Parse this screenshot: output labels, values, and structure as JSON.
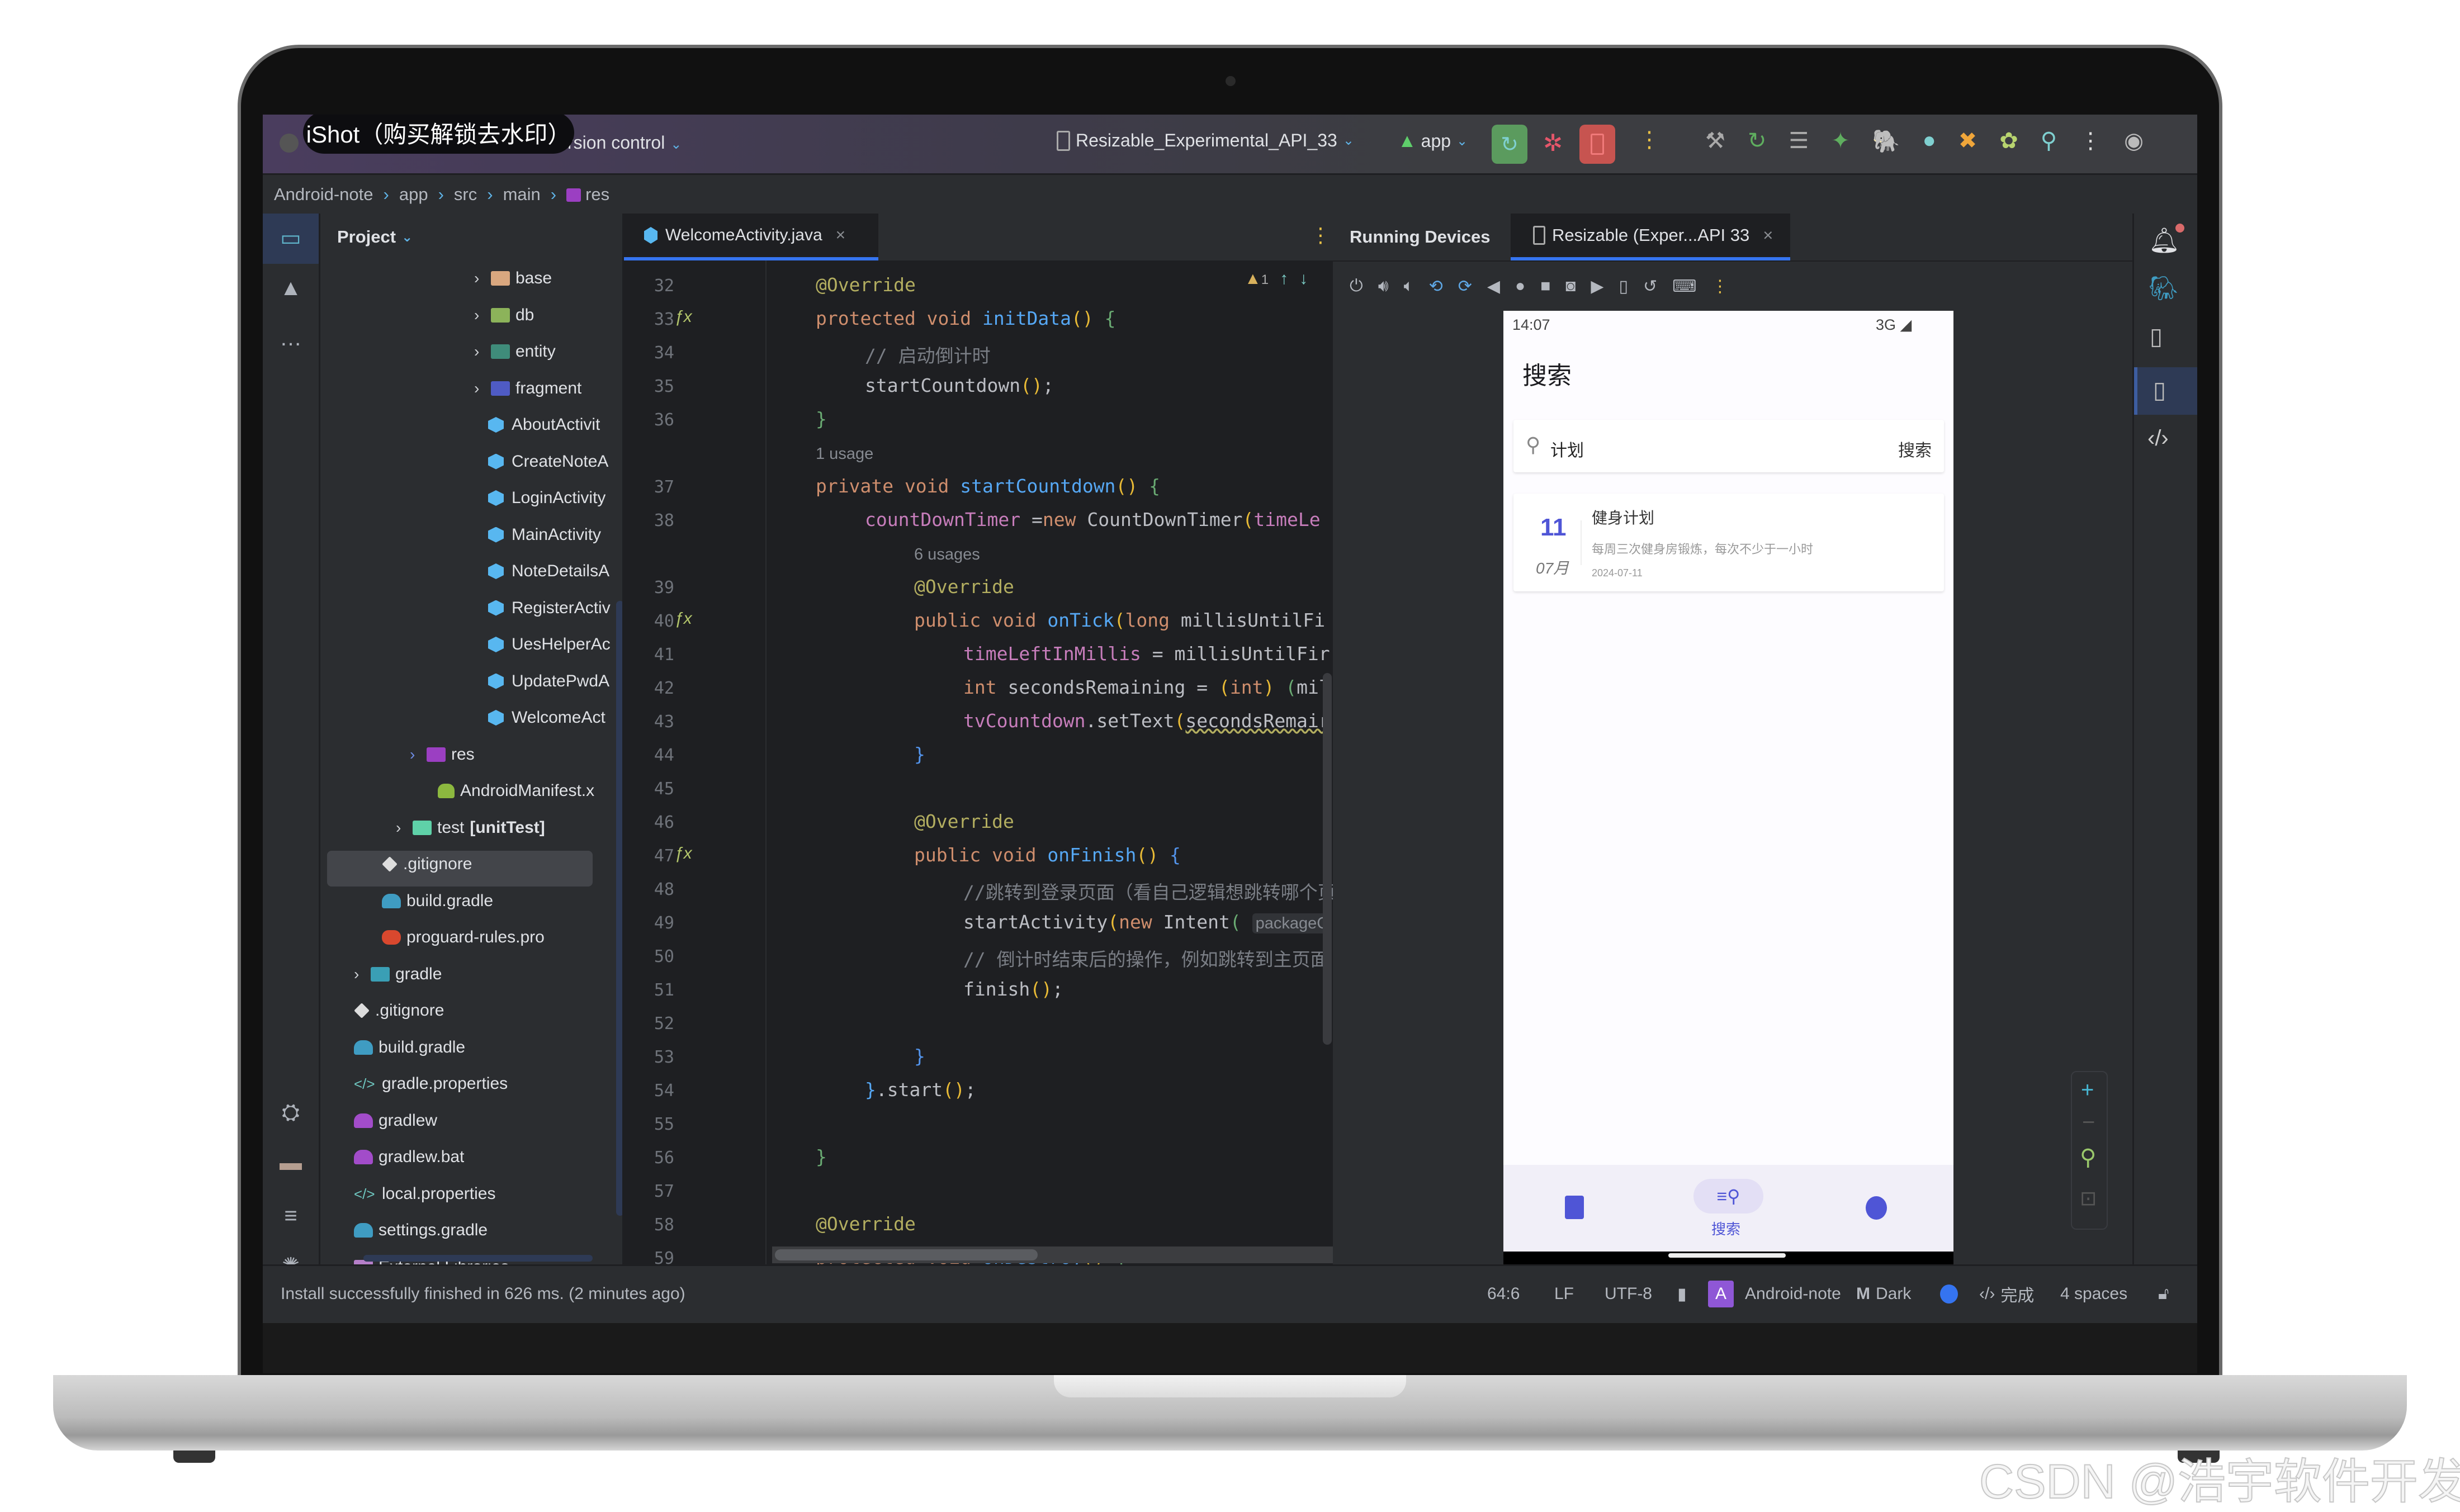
{
  "watermarks": {
    "ishot": "iShot（购买解锁去水印）",
    "csdn": "CSDN @浩宇软件开发"
  },
  "titlebar": {
    "project_name": "Android-note",
    "vcs": "Version control",
    "vcs_visible": "rsion control",
    "device": "Resizable_Experimental_API_33",
    "run_config": "app",
    "colors": {
      "run_green": "#5b9b5e",
      "stop_red": "#c75450",
      "accent": "#3574f0"
    }
  },
  "breadcrumb": {
    "items": [
      "Android-note",
      "app",
      "src",
      "main",
      "res"
    ]
  },
  "left_strip": {
    "icons": [
      "project-icon",
      "resource-manager-icon",
      "more-icon",
      "build-variants-icon",
      "device-explorer-icon",
      "structure-icon",
      "problems-icon",
      "terminal-icon",
      "git-icon"
    ]
  },
  "project": {
    "header": "Project",
    "tree": [
      {
        "label": "base",
        "type": "folder",
        "color": "#d9a77f",
        "expandable": true
      },
      {
        "label": "db",
        "type": "folder",
        "color": "#8cb35a",
        "expandable": true
      },
      {
        "label": "entity",
        "type": "folder",
        "color": "#3f8c7a",
        "expandable": true
      },
      {
        "label": "fragment",
        "type": "folder",
        "color": "#4f5bc4",
        "expandable": true
      },
      {
        "label": "AboutActivit",
        "type": "class"
      },
      {
        "label": "CreateNoteA",
        "type": "class"
      },
      {
        "label": "LoginActivity",
        "type": "class"
      },
      {
        "label": "MainActivity",
        "type": "class"
      },
      {
        "label": "NoteDetailsA",
        "type": "class"
      },
      {
        "label": "RegisterActiv",
        "type": "class"
      },
      {
        "label": "UesHelperAc",
        "type": "class"
      },
      {
        "label": "UpdatePwdA",
        "type": "class"
      },
      {
        "label": "WelcomeAct",
        "type": "class"
      },
      {
        "label": "res",
        "type": "folder",
        "color": "#9b3fc2",
        "expandable": true,
        "selected": true
      },
      {
        "label": "AndroidManifest.x",
        "type": "android"
      },
      {
        "label": "test",
        "suffix": "[unitTest]",
        "type": "folder",
        "color": "#5fd1a8",
        "expandable": true
      },
      {
        "label": ".gitignore",
        "type": "git"
      },
      {
        "label": "build.gradle",
        "type": "gradle"
      },
      {
        "label": "proguard-rules.pro",
        "type": "proguard"
      },
      {
        "label": "gradle",
        "type": "folder",
        "color": "#3a9fb5",
        "expandable": true
      },
      {
        "label": ".gitignore",
        "type": "git"
      },
      {
        "label": "build.gradle",
        "type": "gradle"
      },
      {
        "label": "gradle.properties",
        "type": "properties"
      },
      {
        "label": "gradlew",
        "type": "gradlew"
      },
      {
        "label": "gradlew.bat",
        "type": "gradlew"
      },
      {
        "label": "local.properties",
        "type": "properties"
      },
      {
        "label": "settings.gradle",
        "type": "gradle"
      },
      {
        "label": "External Libraries",
        "type": "library",
        "expandable": true
      }
    ]
  },
  "editor": {
    "tab_label": "WelcomeActivity.java",
    "warnings": "1",
    "lines": [
      {
        "n": "32",
        "html": "<span class='an'>@Override</span>"
      },
      {
        "n": "33",
        "fx": true,
        "html": "<span class='kw'>protected void </span><span class='fn'>initData</span><span class='pr'>()</span> <span class='br'>{</span>"
      },
      {
        "n": "34",
        "indent": 1,
        "html": "<span class='cm'>// 启动倒计时</span>"
      },
      {
        "n": "35",
        "indent": 1,
        "html": "startCountdown<span class='pr'>()</span>;"
      },
      {
        "n": "36",
        "html": "<span class='br'>}</span>"
      },
      {
        "hint": "1 usage"
      },
      {
        "n": "37",
        "html": "<span class='kw'>private void </span><span class='fn'>startCountdown</span><span class='pr'>()</span> <span class='br'>{</span>"
      },
      {
        "n": "38",
        "indent": 1,
        "html": "<span class='fld'>countDownTimer</span> =<span class='kw'>new </span>CountDownTimer<span class='pr'>(</span><span class='fld'>timeLe</span>"
      },
      {
        "hint": "6 usages",
        "indent": 2
      },
      {
        "n": "39",
        "indent": 2,
        "html": "<span class='an'>@Override</span>"
      },
      {
        "n": "40",
        "fx": true,
        "indent": 2,
        "html": "<span class='kw'>public void </span><span class='fn'>onTick</span><span class='pr'>(</span><span class='kw'>long </span>millisUntilFi"
      },
      {
        "n": "41",
        "indent": 3,
        "html": "<span class='fld'>timeLeftInMillis</span> = millisUntilFir"
      },
      {
        "n": "42",
        "indent": 3,
        "html": "<span class='kw'>int </span>secondsRemaining = <span class='pr'>(</span><span class='kw'>int</span><span class='pr'>)</span> <span class='br'>(</span>mil"
      },
      {
        "n": "43",
        "indent": 3,
        "html": "<span class='fld'>tvCountdown</span>.setText<span class='pr'>(</span><span style='text-decoration:underline wavy #b3ae60'>secondsRemair</span>"
      },
      {
        "n": "44",
        "indent": 2,
        "html": "<span class='bb'>}</span>"
      },
      {
        "n": "45",
        "html": ""
      },
      {
        "n": "46",
        "indent": 2,
        "html": "<span class='an'>@Override</span>"
      },
      {
        "n": "47",
        "fx": true,
        "indent": 2,
        "html": "<span class='kw'>public void </span><span class='fn'>onFinish</span><span class='pr'>()</span> <span class='bb'>{</span>"
      },
      {
        "n": "48",
        "indent": 3,
        "html": "<span class='cm'>//跳转到登录页面（看自己逻辑想跳转哪个页</span>"
      },
      {
        "n": "49",
        "indent": 3,
        "html": "startActivity<span class='pr'>(</span><span class='kw'>new </span>Intent<span class='br'>(</span> <span style='background:#313337;color:#868a91;font-family:Liberation Sans,sans-serif;font-size:29px;padding:2px 6px;border-radius:6px'>packageC</span>"
      },
      {
        "n": "50",
        "indent": 3,
        "html": "<span class='cm'>// 倒计时结束后的操作，例如跳转到主页面</span>"
      },
      {
        "n": "51",
        "indent": 3,
        "html": "finish<span class='pr'>()</span>;"
      },
      {
        "n": "52",
        "html": ""
      },
      {
        "n": "53",
        "indent": 2,
        "html": "<span class='bb'>}</span>"
      },
      {
        "n": "54",
        "indent": 1,
        "html": "<span class='fn'>}</span>.start<span class='pr'>()</span>;"
      },
      {
        "n": "55",
        "html": ""
      },
      {
        "n": "56",
        "html": "<span class='br'>}</span>"
      },
      {
        "n": "57",
        "html": ""
      },
      {
        "n": "58",
        "html": "<span class='an'>@Override</span>"
      },
      {
        "n": "59",
        "html": "<span class='kw'>protected void </span><span class='fn'>onDestroy</span><span class='pr'>()</span> <span class='br'>{</span>"
      }
    ]
  },
  "devices": {
    "title": "Running Devices",
    "tab_label": "Resizable (Exper...API 33",
    "toolbar_icons": [
      "power-icon",
      "volume-up-icon",
      "volume-down-icon",
      "rotate-left-icon",
      "rotate-right-icon",
      "back-icon",
      "home-icon",
      "overview-icon",
      "screenshot-icon",
      "screen-record-icon",
      "fold-icon",
      "reset-icon",
      "keyboard-icon",
      "more-icon"
    ],
    "phone": {
      "time": "14:07",
      "network": "3G",
      "page_title": "搜索",
      "search_value": "计划",
      "search_button": "搜索",
      "note": {
        "day": "11",
        "month": "07月",
        "title": "健身计划",
        "content": "每周三次健身房锻炼，每次不少于一小时",
        "date": "2024-07-11"
      },
      "nav": [
        {
          "label": "",
          "icon": "notes-icon"
        },
        {
          "label": "搜索",
          "icon": "search-list-icon",
          "active": true
        },
        {
          "label": "",
          "icon": "profile-icon"
        }
      ],
      "colors": {
        "accent": "#4f55d6",
        "nav_bg": "#f1eff8",
        "nav_pill": "#e3dff5"
      }
    }
  },
  "right_strip": {
    "icons": [
      "notifications-icon",
      "gradle-icon",
      "device-manager-icon",
      "running-devices-icon",
      "app-inspection-icon"
    ]
  },
  "statusbar": {
    "message": "Install successfully finished in 626 ms. (2 minutes ago)",
    "position": "64:6",
    "line_sep": "LF",
    "encoding": "UTF-8",
    "project": "Android-note",
    "project_badge": "A",
    "theme": "Dark",
    "done": "完成",
    "indent": "4 spaces"
  }
}
